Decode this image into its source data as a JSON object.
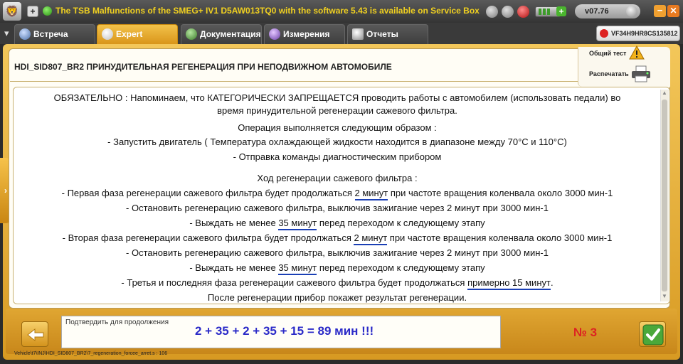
{
  "titlebar": {
    "banner": "The TSB Malfunctions of the SMEG+ IV1 D5AW013TQ0 with the software 5.43 is available on Service Box",
    "version": "v07.76",
    "add_symbol": "+",
    "minimize_symbol": "−",
    "close_symbol": "✕"
  },
  "tabs": [
    {
      "label": "Встреча"
    },
    {
      "label": "Expert"
    },
    {
      "label": "Документация"
    },
    {
      "label": "Измерения"
    },
    {
      "label": "Отчеты"
    }
  ],
  "vin": "VF34H9HR8CS135812",
  "page": {
    "title": "HDI_SID807_BR2  ПРИНУДИТЕЛЬНАЯ РЕГЕНЕРАЦИЯ ПРИ НЕПОДВИЖНОМ АВТОМОБИЛЕ"
  },
  "actions": {
    "general_test": "Общий тест",
    "print": "Распечатать"
  },
  "message": {
    "l1": "ОБЯЗАТЕЛЬНО : Напоминаем, что КАТЕГОРИЧЕСКИ ЗАПРЕЩАЕТСЯ проводить работы с автомобилем (использовать педали) во",
    "l2": "время принудительной регенерации сажевого фильтра.",
    "l3": "Операция выполняется следующим образом :",
    "l4": "- Запустить двигатель ( Температура охлаждающей жидкости находится в диапазоне между 70°C и 110°C)",
    "l5": "- Отправка команды диагностическим прибором",
    "l6": "Ход регенерации сажевого фильтра :",
    "l7a": "- Первая фаза регенерации сажевого фильтра будет продолжаться ",
    "l7u": "2 минут",
    "l7b": " при частоте вращения коленвала около 3000 мин-1",
    "l8": "- Остановить регенерацию сажевого фильтра, выключив зажигание через 2 минут при 3000 мин-1",
    "l9a": "- Выждать не менее ",
    "l9u": "35 минут",
    "l9b": " перед переходом к следующему этапу",
    "l10a": "- Вторая фаза регенерации сажевого фильтра будет продолжаться ",
    "l10u": "2 минут",
    "l10b": " при частоте вращения коленвала около 3000 мин-1",
    "l11": "- Остановить регенерацию сажевого фильтра, выключив зажигание через 2 минут при 3000 мин-1",
    "l12a": "- Выждать не менее ",
    "l12u": "35 минут",
    "l12b": " перед переходом к следующему этапу",
    "l13a": "- Третья и последняя фаза регенерации сажевого фильтра будет продолжаться ",
    "l13u": "примерно 15 минут",
    "l13b": ".",
    "l14": "После регенерации прибор покажет результат регенерации."
  },
  "bottom": {
    "confirm_label": "Подтвердить для продолжения",
    "sum_note": "2 + 35 + 2 + 35 + 15 = 89 мин !!!",
    "number_badge": "№ 3",
    "status_path": "Vehicle\\t7\\INJ\\HDI_SID807_BR2\\7_regeneration_forcee_arret.s : 106"
  },
  "colors": {
    "accent": "#E8A62A",
    "banner_text": "#F0D020",
    "underline": "#1A3FB5",
    "sum_note": "#2A2AC8",
    "number_badge": "#DD2222"
  },
  "icons": [
    "app-logo-icon",
    "expand-icon",
    "info-icon",
    "shutdown-icon",
    "cancel-icon",
    "record-icon",
    "battery-icon",
    "add-icon",
    "version-knob-icon",
    "minimize-icon",
    "close-icon",
    "chevron-down-icon",
    "warning-icon",
    "printer-icon",
    "back-arrow-icon",
    "checkmark-icon"
  ]
}
